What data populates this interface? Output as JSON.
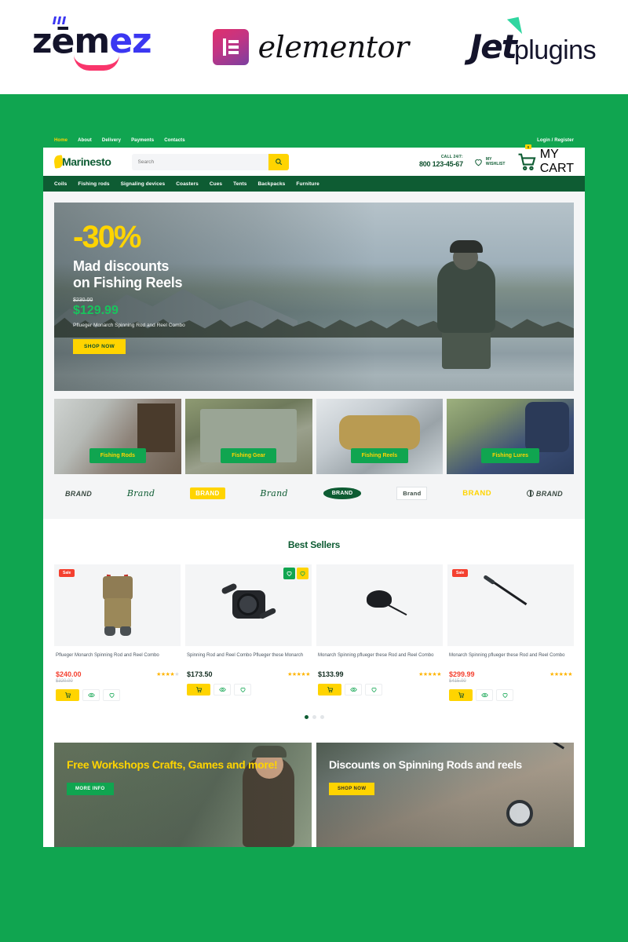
{
  "brandbar": {
    "logos": [
      {
        "name": "zemes",
        "text_a": "z",
        "text_b": "ēm",
        "text_c": "e",
        "text_d": "z"
      },
      {
        "name": "elementor",
        "word": "elementor"
      },
      {
        "name": "jetplugins",
        "word_a": "Jet",
        "word_b": "plugins"
      }
    ]
  },
  "site": {
    "utility": {
      "links": [
        {
          "label": "Home",
          "active": true
        },
        {
          "label": "About",
          "active": false
        },
        {
          "label": "Delivery",
          "active": false
        },
        {
          "label": "Payments",
          "active": false
        },
        {
          "label": "Contacts",
          "active": false
        }
      ],
      "account": "Login / Register"
    },
    "header": {
      "brand_name": "Marinesto",
      "search_placeholder": "Search",
      "search_value": "",
      "search_icon": "search-icon",
      "call_label": "CALL 24/7:",
      "call_number": "800 123-45-67",
      "wishlist_line1": "MY",
      "wishlist_line2": "WISHLIST",
      "cart_count": "0",
      "cart_label": "MY CART"
    },
    "catnav": [
      {
        "label": "Coils"
      },
      {
        "label": "Fishing rods"
      },
      {
        "label": "Signaling devices"
      },
      {
        "label": "Coasters"
      },
      {
        "label": "Cues"
      },
      {
        "label": "Tents"
      },
      {
        "label": "Backpacks"
      },
      {
        "label": "Furniture"
      }
    ],
    "hero": {
      "percent": "-30%",
      "headline_line1": "Mad discounts",
      "headline_line2": "on Fishing Reels",
      "old_price": "$230.00",
      "new_price": "$129.99",
      "description": "Pflueger Monarch Spinning Rod and Reel Combo",
      "button": "SHOP NOW"
    },
    "tiles": [
      {
        "label": "Fishing Rods"
      },
      {
        "label": "Fishing Gear"
      },
      {
        "label": "Fishing Reels"
      },
      {
        "label": "Fishing Lures"
      }
    ],
    "brands": [
      {
        "label": "BRAND",
        "style": "italic"
      },
      {
        "label": "Brand",
        "style": "script"
      },
      {
        "label": "BRAND",
        "style": "chip"
      },
      {
        "label": "Brand",
        "style": "script2"
      },
      {
        "label": "BRAND",
        "style": "oval"
      },
      {
        "label": "Brand",
        "style": "box"
      },
      {
        "label": "BRAND",
        "style": "yellow"
      },
      {
        "label": "BRAND",
        "style": "circle"
      }
    ],
    "best_sellers": {
      "title": "Best Sellers",
      "products": [
        {
          "badge": "Sale",
          "name": "Pflueger Monarch Spinning Rod and Reel Combo",
          "price": "$240.00",
          "price_style": "red",
          "old_price": "$320.00",
          "rating": 4,
          "cart_label": "cart-icon",
          "view_label": "eye-icon",
          "wish_label": "heart-icon"
        },
        {
          "badge": "",
          "name": "Spinning Rod and Reel Combo Pflueger these Monarch",
          "price": "$173.50",
          "price_style": "dark",
          "old_price": "",
          "rating": 5,
          "cart_label": "cart-icon",
          "view_label": "eye-icon",
          "wish_label": "heart-icon"
        },
        {
          "badge": "",
          "name": "Monarch Spinning pflueger these Rod and Reel Combo",
          "price": "$133.99",
          "price_style": "dark",
          "old_price": "",
          "rating": 5,
          "cart_label": "cart-icon",
          "view_label": "eye-icon",
          "wish_label": "heart-icon"
        },
        {
          "badge": "Sale",
          "name": "Monarch Spinning pflueger these Rod and Reel Combo",
          "price": "$299.99",
          "price_style": "red",
          "old_price": "$415.00",
          "rating": 5,
          "cart_label": "cart-icon",
          "view_label": "eye-icon",
          "wish_label": "heart-icon"
        }
      ],
      "dots": [
        true,
        false,
        false
      ]
    },
    "promos": [
      {
        "headline": "Free Workshops Crafts, Games and more!",
        "button": "MORE INFO",
        "button_style": "green"
      },
      {
        "headline": "Discounts on Spinning Rods and reels",
        "button": "SHOP NOW",
        "button_style": "yellow"
      }
    ]
  },
  "colors": {
    "green": "#10a550",
    "dark_green": "#0e5c33",
    "yellow": "#ffd400",
    "red": "#f4402f",
    "star": "#ffb400"
  }
}
